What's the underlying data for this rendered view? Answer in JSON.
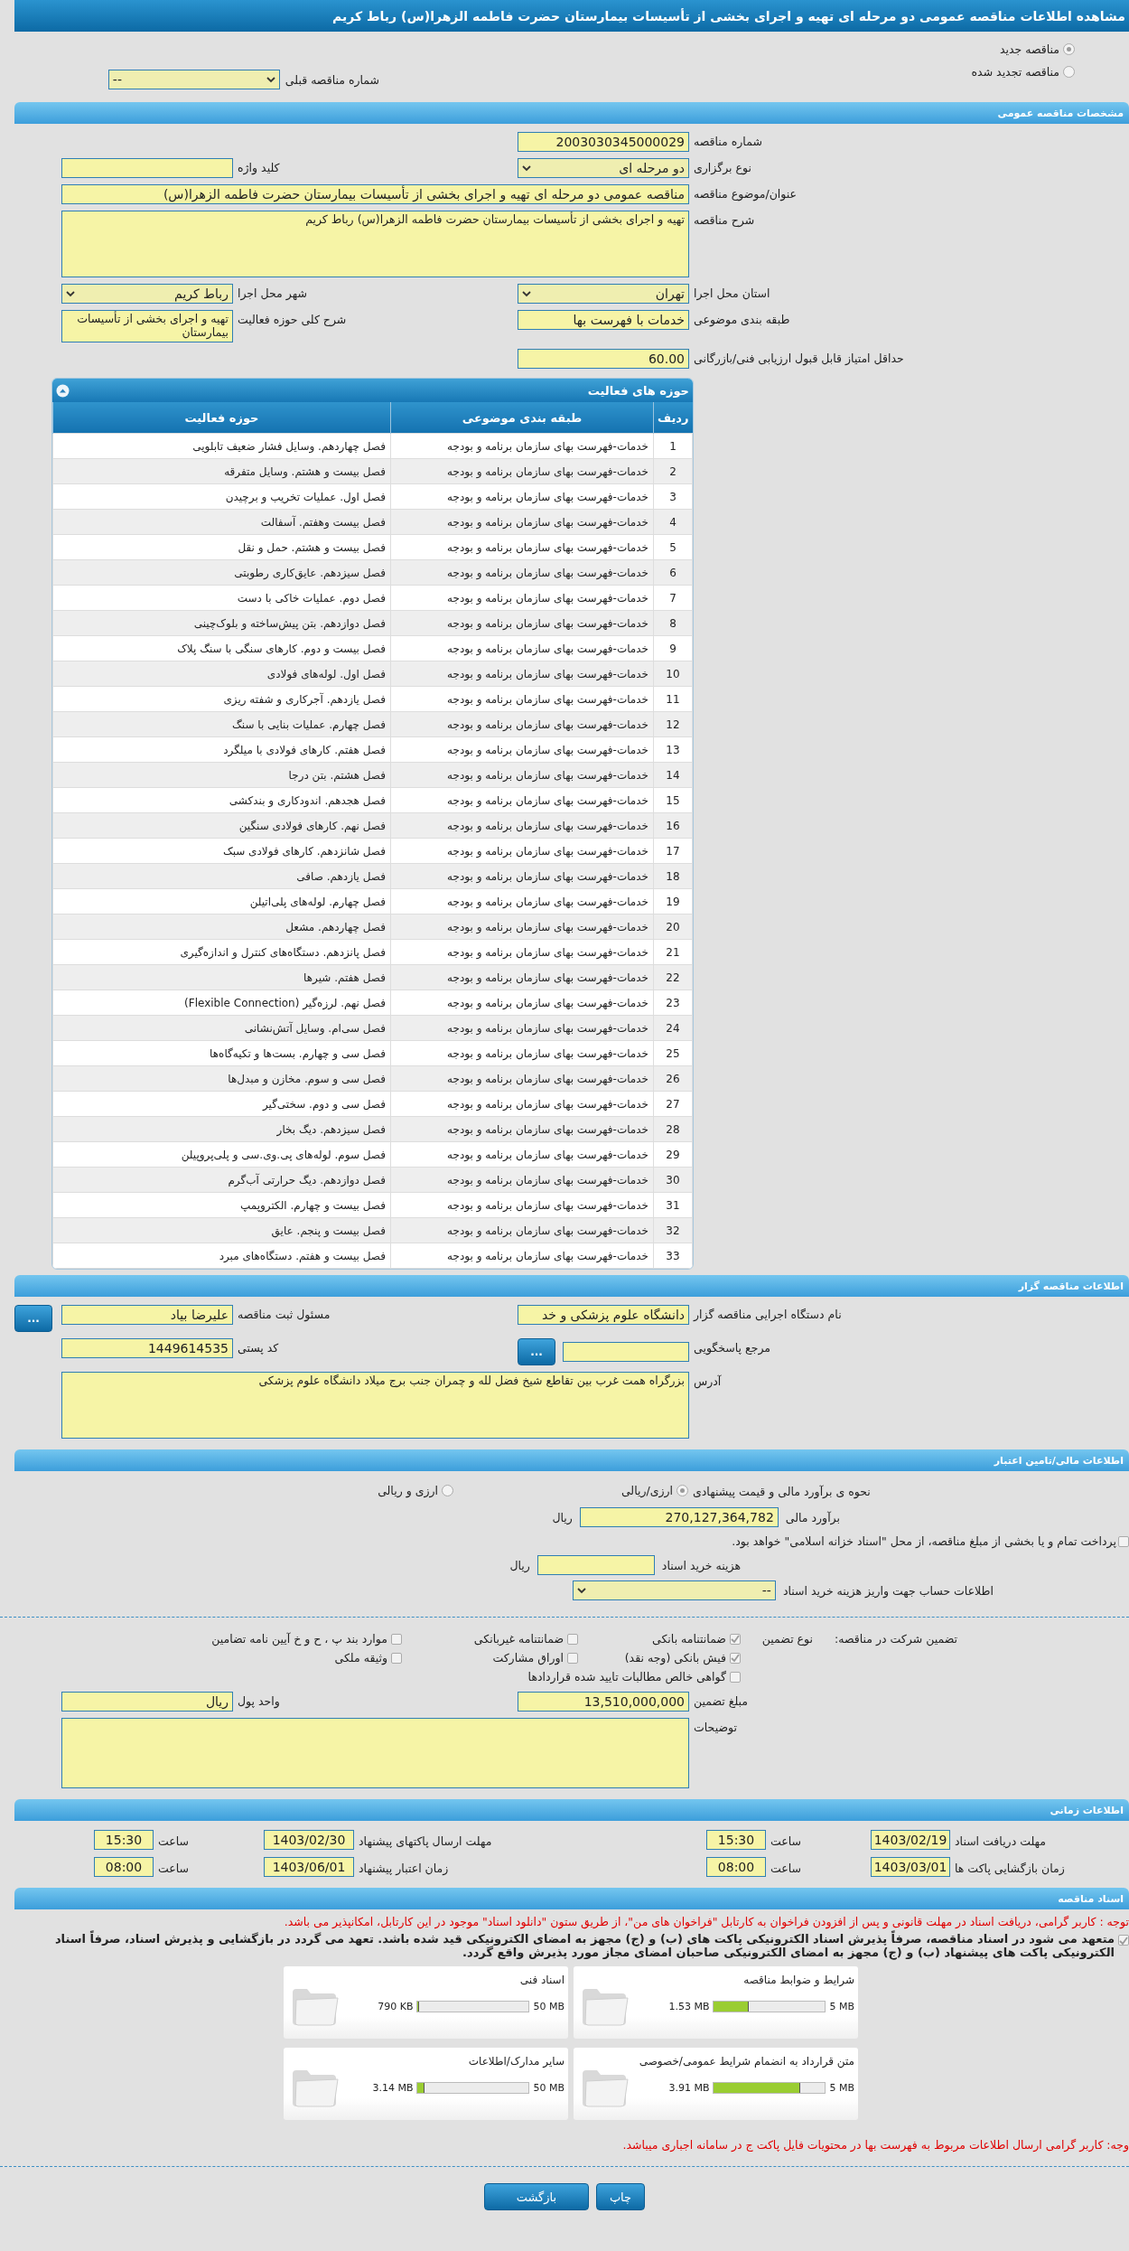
{
  "header": {
    "title": "مشاهده اطلاعات مناقصه عمومی دو مرحله ای تهیه و اجرای بخشی از تأسیسات بیمارستان حضرت فاطمه الزهرا(س) رباط کریم"
  },
  "tender_type": [
    {
      "label": "مناقصه جدید",
      "selected": true
    },
    {
      "label": "مناقصه تجدید شده",
      "selected": false
    }
  ],
  "previous_tender": {
    "label": "شماره مناقصه قبلی",
    "value": "--"
  },
  "general": {
    "title": "مشخصات مناقصه عمومی",
    "rows": [
      [
        {
          "kind": "input",
          "label": "شماره مناقصه",
          "value": "2003030345000029"
        }
      ],
      [
        {
          "kind": "select",
          "label": "نوع برگزاری",
          "value": "دو مرحله ای"
        },
        {
          "kind": "input",
          "label": "کلید واژه"
        }
      ],
      [
        {
          "kind": "wide",
          "label": "عنوان/موضوع مناقصه",
          "value": "مناقصه عمومی دو مرحله ای تهیه و اجرای بخشی از تأسیسات بیمارستان حضرت فاطمه الزهرا(س)"
        }
      ],
      [
        {
          "kind": "textarea",
          "label": "شرح مناقصه",
          "value": "تهیه و اجرای بخشی از تأسیسات بیمارستان حضرت فاطمه الزهرا(س) رباط کریم"
        }
      ],
      [
        {
          "kind": "select",
          "label": "استان محل اجرا",
          "value": "تهران"
        },
        {
          "kind": "select",
          "label": "شهر محل اجرا",
          "value": "رباط کریم"
        }
      ],
      [
        {
          "kind": "input",
          "label": "طبقه بندی موضوعی",
          "value": "خدمات با فهرست بها"
        },
        {
          "kind": "multiline",
          "label": "شرح کلی حوزه فعالیت",
          "value": "تهیه و اجرای بخشی از تأسیسات بیمارستان"
        }
      ],
      [
        {
          "kind": "input",
          "label": "حداقل امتیاز قابل قبول ارزیابی فنی/بازرگانی",
          "value": "60.00"
        }
      ]
    ]
  },
  "activities": {
    "title": "حوزه های فعالیت",
    "columns": [
      "ردیف",
      "طبقه بندی موضوعی",
      "حوزه فعالیت"
    ],
    "rows": [
      [
        "1",
        "خدمات-فهرست بهای سازمان برنامه و بودجه",
        "فصل چهاردهم. وسایل فشار ضعیف تابلویی"
      ],
      [
        "2",
        "خدمات-فهرست بهای سازمان برنامه و بودجه",
        "فصل بیست و هشتم. وسایل متفرقه"
      ],
      [
        "3",
        "خدمات-فهرست بهای سازمان برنامه و بودجه",
        "فصل اول. عملیات تخریب و برچیدن"
      ],
      [
        "4",
        "خدمات-فهرست بهای سازمان برنامه و بودجه",
        "فصل بیست وهفتم. آسفالت"
      ],
      [
        "5",
        "خدمات-فهرست بهای سازمان برنامه و بودجه",
        "فصل بیست و هشتم. حمل و نقل"
      ],
      [
        "6",
        "خدمات-فهرست بهای سازمان برنامه و بودجه",
        "فصل سیزدهم. عایق‌کاری رطوبتی"
      ],
      [
        "7",
        "خدمات-فهرست بهای سازمان برنامه و بودجه",
        "فصل دوم. عملیات خاکی با دست"
      ],
      [
        "8",
        "خدمات-فهرست بهای سازمان برنامه و بودجه",
        "فصل دوازدهم. بتن پیش‌ساخته و بلوک‌چینی"
      ],
      [
        "9",
        "خدمات-فهرست بهای سازمان برنامه و بودجه",
        "فصل بیست و دوم. کارهای سنگی با سنگ پلاک"
      ],
      [
        "10",
        "خدمات-فهرست بهای سازمان برنامه و بودجه",
        "فصل اول. لوله‌های فولادی"
      ],
      [
        "11",
        "خدمات-فهرست بهای سازمان برنامه و بودجه",
        "فصل یازدهم. آجرکاری و شفته ریزی"
      ],
      [
        "12",
        "خدمات-فهرست بهای سازمان برنامه و بودجه",
        "فصل چهارم. عملیات بنایی با سنگ"
      ],
      [
        "13",
        "خدمات-فهرست بهای سازمان برنامه و بودجه",
        "فصل هفتم. کارهای فولادی با میلگرد"
      ],
      [
        "14",
        "خدمات-فهرست بهای سازمان برنامه و بودجه",
        "فصل هشتم. بتن درجا"
      ],
      [
        "15",
        "خدمات-فهرست بهای سازمان برنامه و بودجه",
        "فصل هجدهم. اندودکاری و بندکشی"
      ],
      [
        "16",
        "خدمات-فهرست بهای سازمان برنامه و بودجه",
        "فصل نهم. کارهای فولادی سنگین"
      ],
      [
        "17",
        "خدمات-فهرست بهای سازمان برنامه و بودجه",
        "فصل شانزدهم. کارهای فولادی سبک"
      ],
      [
        "18",
        "خدمات-فهرست بهای سازمان برنامه و بودجه",
        "فصل یازدهم. صافی"
      ],
      [
        "19",
        "خدمات-فهرست بهای سازمان برنامه و بودجه",
        "فصل چهارم. لوله‌های پلی‌اتیلن"
      ],
      [
        "20",
        "خدمات-فهرست بهای سازمان برنامه و بودجه",
        "فصل چهاردهم. مشعل"
      ],
      [
        "21",
        "خدمات-فهرست بهای سازمان برنامه و بودجه",
        "فصل پانزدهم. دستگاه‌های کنترل و اندازه‌گیری"
      ],
      [
        "22",
        "خدمات-فهرست بهای سازمان برنامه و بودجه",
        "فصل هفتم. شیرها"
      ],
      [
        "23",
        "خدمات-فهرست بهای سازمان برنامه و بودجه",
        "فصل نهم. لرزه‌گیر (Flexible Connection)"
      ],
      [
        "24",
        "خدمات-فهرست بهای سازمان برنامه و بودجه",
        "فصل سی‌ام. وسایل آتش‌نشانی"
      ],
      [
        "25",
        "خدمات-فهرست بهای سازمان برنامه و بودجه",
        "فصل سی و چهارم. بست‌ها و تکیه‌گاه‌ها"
      ],
      [
        "26",
        "خدمات-فهرست بهای سازمان برنامه و بودجه",
        "فصل سی و سوم. مخازن و مبدل‌ها"
      ],
      [
        "27",
        "خدمات-فهرست بهای سازمان برنامه و بودجه",
        "فصل سی و دوم. سختی‌گیر"
      ],
      [
        "28",
        "خدمات-فهرست بهای سازمان برنامه و بودجه",
        "فصل سیزدهم. دیگ بخار"
      ],
      [
        "29",
        "خدمات-فهرست بهای سازمان برنامه و بودجه",
        "فصل سوم. لوله‌های پی.وی.سی و پلی‌پروپیلن"
      ],
      [
        "30",
        "خدمات-فهرست بهای سازمان برنامه و بودجه",
        "فصل دوازدهم. دیگ حرارتی آب‌گرم"
      ],
      [
        "31",
        "خدمات-فهرست بهای سازمان برنامه و بودجه",
        "فصل بیست و چهارم. الکتروپمپ"
      ],
      [
        "32",
        "خدمات-فهرست بهای سازمان برنامه و بودجه",
        "فصل بیست و پنجم. عایق"
      ],
      [
        "33",
        "خدمات-فهرست بهای سازمان برنامه و بودجه",
        "فصل بیست و هفتم. دستگاه‌های مبرد"
      ]
    ]
  },
  "organizer": {
    "title": "اطلاعات مناقصه گزار",
    "rows": [
      [
        {
          "kind": "input",
          "label": "نام دستگاه اجرایی مناقصه گزار",
          "value": "دانشگاه علوم پزشکی و خد"
        },
        {
          "kind": "input",
          "label": "مسئول ثبت مناقصه",
          "value": "علیرضا بیاد",
          "button": "..."
        }
      ],
      [
        {
          "kind": "input",
          "label": "مرجع پاسخگویی",
          "button": "..."
        },
        {
          "kind": "input",
          "label": "کد پستی",
          "value": "1449614535"
        }
      ],
      [
        {
          "kind": "textarea",
          "label": "آدرس",
          "value": "بزرگراه همت غرب بین تقاطع شیخ فضل لله و چمران جنب برج میلاد دانشگاه علوم پزشکی"
        }
      ]
    ]
  },
  "finance": {
    "title": "اطلاعات مالی/تامین اعتبار",
    "pricing": {
      "label": "نحوه ی برآورد مالی و قیمت پیشنهادی",
      "options": [
        {
          "label": "ارزی/ریالی",
          "selected": true
        },
        {
          "label": "ارزی و ریالی",
          "selected": false
        }
      ]
    },
    "estimate": {
      "label": "برآورد مالی",
      "value": "270,127,364,782",
      "unit": "ریال"
    },
    "treasury": {
      "checked": false,
      "text": "پرداخت تمام و یا بخشی از مبلغ مناقصه، از محل \"اسناد خزانه اسلامی\" خواهد بود."
    },
    "doc_fee": {
      "label": "هزینه خرید اسناد",
      "unit": "ریال"
    },
    "account": {
      "label": "اطلاعات حساب جهت واریز هزینه خرید اسناد",
      "value": "--"
    },
    "guarantee": {
      "label": "تضمین شرکت در مناقصه:",
      "type_label": "نوع تضمین",
      "options": [
        {
          "label": "ضمانتنامه بانکی",
          "checked": true
        },
        {
          "label": "ضمانتنامه غیربانکی",
          "checked": false
        },
        {
          "label": "موارد بند پ ، ح و خ آیین نامه تضامین",
          "checked": false
        },
        {
          "label": "فیش بانکی (وجه نقد)",
          "checked": true
        },
        {
          "label": "اوراق مشارکت",
          "checked": false
        },
        {
          "label": "وثیقه ملکی",
          "checked": false
        },
        {
          "label": "گواهی خالص مطالبات تایید شده قراردادها",
          "checked": false
        }
      ]
    },
    "rows": [
      [
        {
          "kind": "input",
          "label": "مبلغ تضمین",
          "value": "13,510,000,000"
        },
        {
          "kind": "input",
          "label": "واحد پول",
          "value": "ریال"
        }
      ],
      [
        {
          "kind": "notes",
          "label": "توضیحات"
        }
      ]
    ]
  },
  "timing": {
    "title": "اطلاعات زمانی",
    "rows": [
      [
        {
          "label": "مهلت دریافت اسناد",
          "value": "1403/02/19"
        },
        {
          "label": "ساعت",
          "value": "15:30"
        },
        {
          "label": "مهلت ارسال پاکتهای پیشنهاد",
          "value": "1403/02/30"
        },
        {
          "label": "ساعت",
          "value": "15:30"
        }
      ],
      [
        {
          "label": "زمان بازگشایی پاکت ها",
          "value": "1403/03/01"
        },
        {
          "label": "ساعت",
          "value": "08:00"
        },
        {
          "label": "زمان اعتبار پیشنهاد",
          "value": "1403/06/01"
        },
        {
          "label": "ساعت",
          "value": "08:00"
        }
      ]
    ]
  },
  "documents": {
    "title": "اسناد مناقصه",
    "notice": "توجه : کاربر گرامی، دریافت اسناد در مهلت قانونی و پس از افزودن فراخوان به کارتابل \"فراخوان های من\"، از طریق ستون \"دانلود اسناد\" موجود در این کارتابل، امکانپذیر می باشد.",
    "pledge": {
      "checked": true,
      "text": "متعهد می شود در اسناد مناقصه، صرفاً پذیرش اسناد الکترونیکی پاکت های (ب) و (ج) مجهز به امضای الکترونیکی قید شده باشد. تعهد می گردد در بازگشایی و پذیرش اسناد، صرفاً اسناد الکترونیکی پاکت های پیشنهاد (ب) و (ج) مجهز به امضای الکترونیکی صاحبان امضای مجاز مورد پذیرش واقع گردد."
    },
    "files": [
      {
        "title": "شرایط و ضوابط مناقصه",
        "size": "1.53 MB",
        "max": "5 MB",
        "level": 0.31
      },
      {
        "title": "اسناد فنی",
        "size": "790 KB",
        "max": "50 MB",
        "level": 0.015
      },
      {
        "title": "متن قرارداد به انضمام شرایط عمومی/خصوصی",
        "size": "3.91 MB",
        "max": "5 MB",
        "level": 0.78
      },
      {
        "title": "سایر مدارک/اطلاعات",
        "size": "3.14 MB",
        "max": "50 MB",
        "level": 0.063
      }
    ],
    "footer_notice": "وجه: کاربر گرامی ارسال اطلاعات مربوط به فهرست بها در محتویات فایل پاکت ج در سامانه اجباری میباشد."
  },
  "buttons": [
    "چاپ",
    "بازگشت"
  ]
}
